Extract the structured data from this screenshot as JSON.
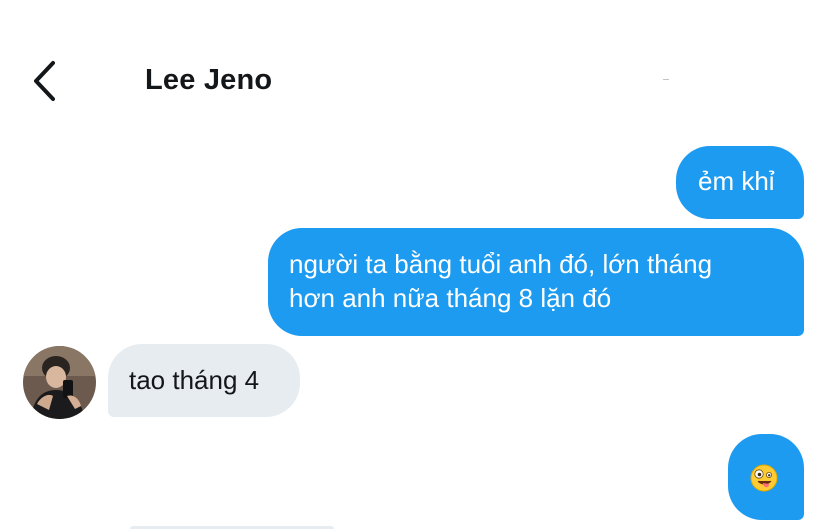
{
  "header": {
    "title": "Lee Jeno",
    "back_icon": "chevron-left-icon"
  },
  "messages": [
    {
      "direction": "outgoing",
      "text": "ẻm khỉ"
    },
    {
      "direction": "outgoing",
      "lines": [
        "người ta bằng tuổi anh đó, lớn tháng",
        "hơn anh nữa tháng 8 lặn đó"
      ]
    },
    {
      "direction": "incoming",
      "text": "tao tháng 4",
      "avatar_icon": "contact-avatar"
    },
    {
      "direction": "outgoing",
      "emoji": "zany-face-emoji"
    }
  ],
  "colors": {
    "outgoing_bubble": "#1d9bf0",
    "incoming_bubble": "#e7ecf0",
    "text": "#14171a"
  }
}
